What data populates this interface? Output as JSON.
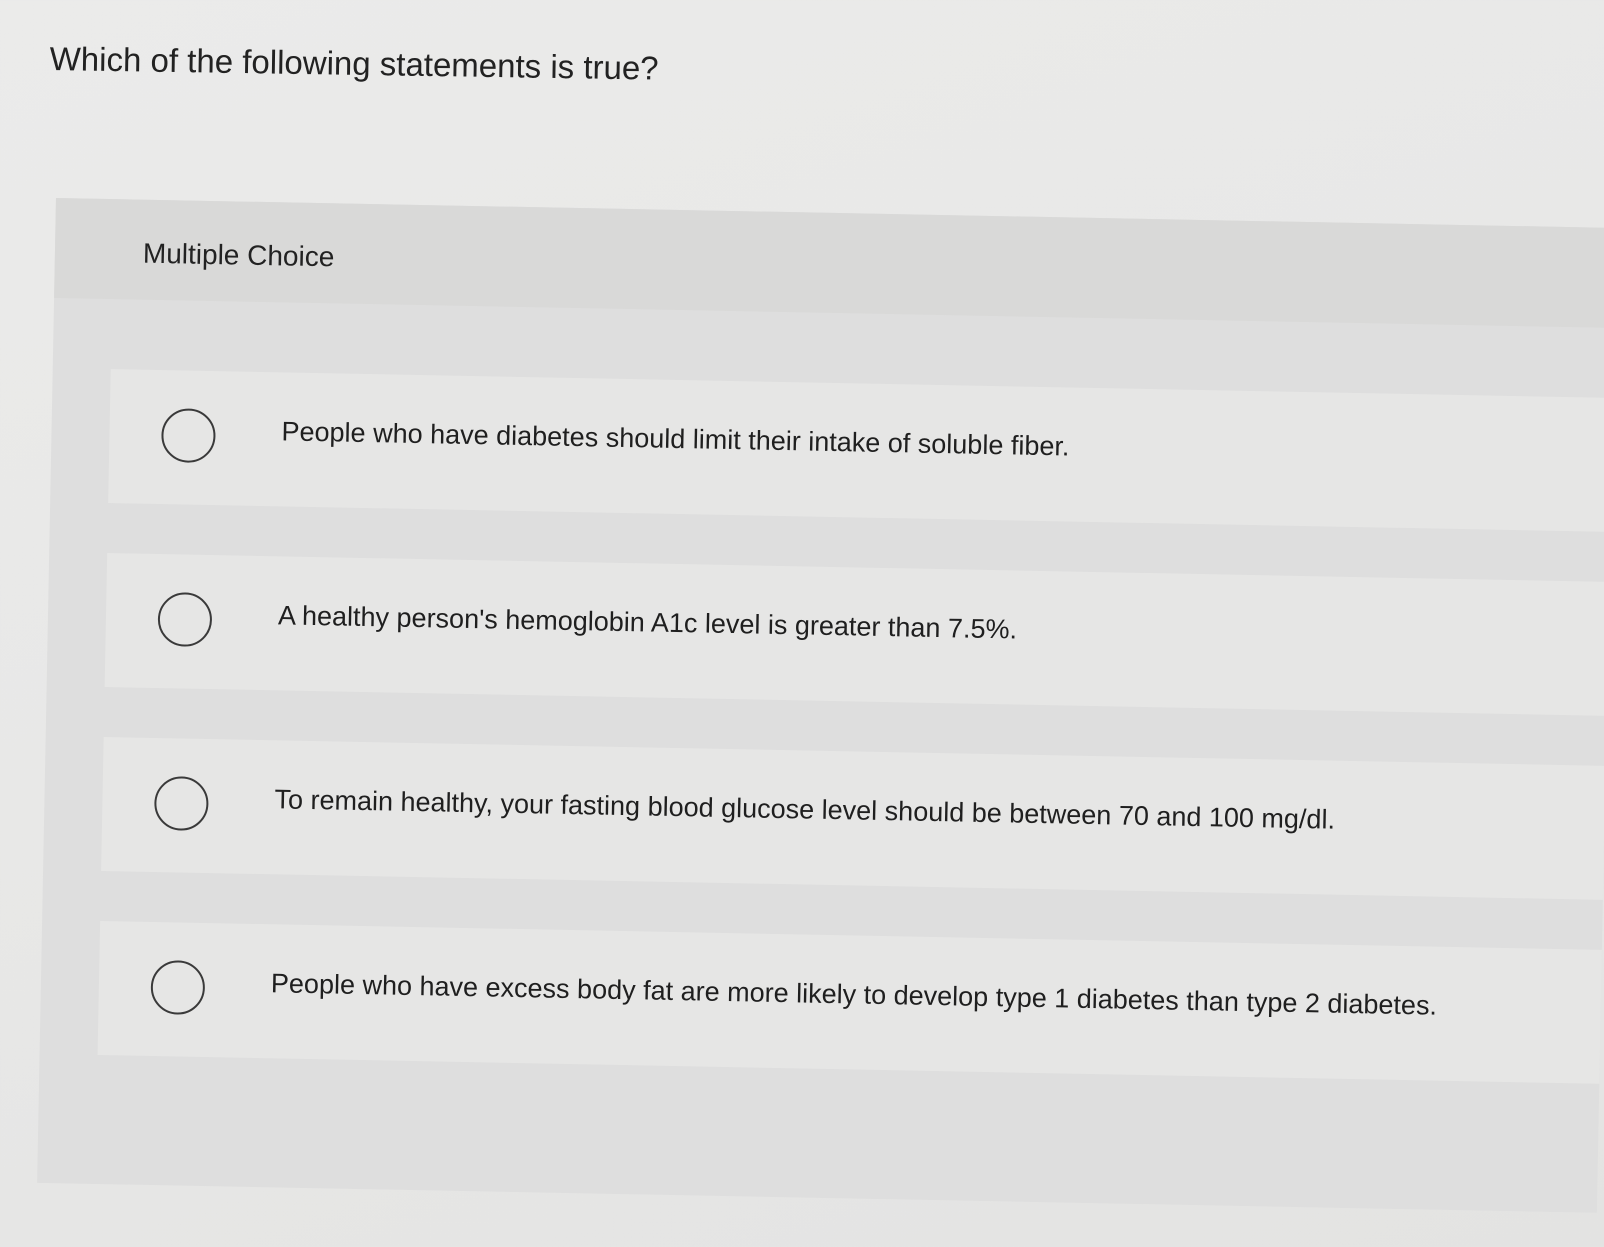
{
  "question": {
    "text": "Which of the following statements is true?"
  },
  "panel": {
    "label": "Multiple Choice"
  },
  "options": [
    {
      "label": "People who have diabetes should limit their intake of soluble fiber.",
      "selected": false
    },
    {
      "label": "A healthy person's hemoglobin A1c level is greater than 7.5%.",
      "selected": false
    },
    {
      "label": "To remain healthy, your fasting blood glucose level should be between 70 and 100 mg/dl.",
      "selected": false
    },
    {
      "label": "People who have excess body fat are more likely to develop type 1 diabetes than type 2 diabetes.",
      "selected": false
    }
  ]
}
